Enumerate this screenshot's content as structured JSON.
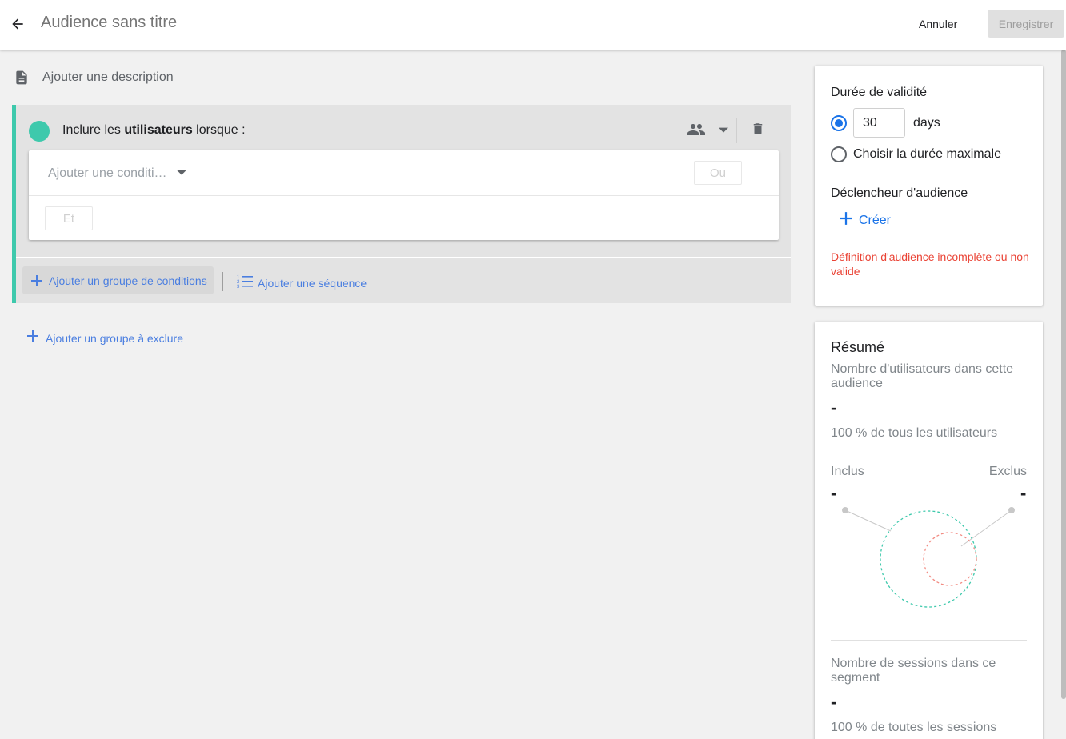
{
  "header": {
    "title_placeholder": "Audience sans titre",
    "cancel_label": "Annuler",
    "save_label": "Enregistrer"
  },
  "description": {
    "label": "Ajouter une description",
    "icon": "description-icon"
  },
  "include_group": {
    "title_prefix": "Inclure les ",
    "title_bold": "utilisateurs",
    "title_suffix": " lorsque :",
    "accent_color": "#3ec9ac",
    "condition_placeholder": "Ajouter une conditi…",
    "or_label": "Ou",
    "and_label": "Et",
    "add_condition_group_label": "Ajouter un groupe de conditions",
    "add_sequence_label": "Ajouter une séquence"
  },
  "add_exclude_label": "Ajouter un groupe à exclure",
  "validity": {
    "title": "Durée de validité",
    "days_value": "30",
    "days_label": "days",
    "max_label": "Choisir la durée maximale",
    "trigger_title": "Déclencheur d'audience",
    "create_label": "Créer",
    "error": "Définition d'audience incomplète ou non valide"
  },
  "summary": {
    "title": "Résumé",
    "users_label": "Nombre d'utilisateurs dans cette audience",
    "users_value": "-",
    "users_pct": "100 % de tous les utilisateurs",
    "included_label": "Inclus",
    "excluded_label": "Exclus",
    "included_value": "-",
    "excluded_value": "-",
    "sessions_label": "Nombre de sessions dans ce segment",
    "sessions_value": "-",
    "sessions_pct": "100 % de toutes les sessions"
  },
  "colors": {
    "link": "#4a7ee0",
    "primary": "#1a73e8",
    "error": "#ea4335",
    "include": "#3ec9ac",
    "exclude": "#f28b82"
  }
}
